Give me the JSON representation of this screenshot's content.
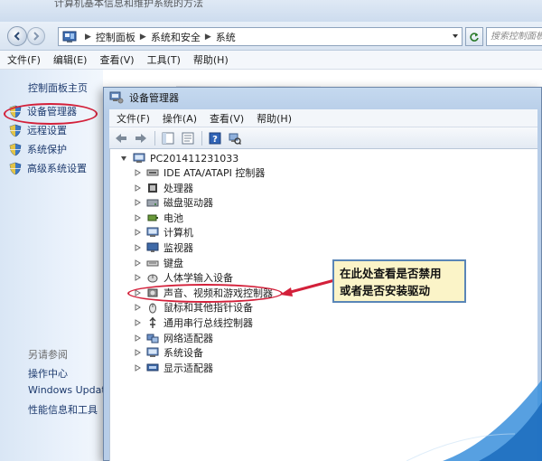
{
  "control_panel": {
    "title_fragment": "计算机基本信息和维护系统的方法",
    "address": {
      "crumbs": [
        "控制面板",
        "系统和安全",
        "系统"
      ]
    },
    "search_placeholder": "搜索控制面板",
    "menu": [
      "文件(F)",
      "编辑(E)",
      "查看(V)",
      "工具(T)",
      "帮助(H)"
    ],
    "sidebar": {
      "home": "控制面板主页",
      "links": [
        "设备管理器",
        "远程设置",
        "系统保护",
        "高级系统设置"
      ],
      "see_also_heading": "另请参阅",
      "see_also": [
        "操作中心",
        "Windows Update",
        "性能信息和工具"
      ]
    }
  },
  "device_manager": {
    "title": "设备管理器",
    "menu": [
      "文件(F)",
      "操作(A)",
      "查看(V)",
      "帮助(H)"
    ],
    "root": "PC201411231033",
    "categories": [
      {
        "label": "IDE ATA/ATAPI 控制器",
        "icon": "ide-controller-icon"
      },
      {
        "label": "处理器",
        "icon": "processor-icon"
      },
      {
        "label": "磁盘驱动器",
        "icon": "disk-drive-icon"
      },
      {
        "label": "电池",
        "icon": "battery-icon"
      },
      {
        "label": "计算机",
        "icon": "computer-icon"
      },
      {
        "label": "监视器",
        "icon": "monitor-icon"
      },
      {
        "label": "键盘",
        "icon": "keyboard-icon"
      },
      {
        "label": "人体学输入设备",
        "icon": "hid-icon"
      },
      {
        "label": "声音、视频和游戏控制器",
        "icon": "sound-icon"
      },
      {
        "label": "鼠标和其他指针设备",
        "icon": "mouse-icon"
      },
      {
        "label": "通用串行总线控制器",
        "icon": "usb-icon"
      },
      {
        "label": "网络适配器",
        "icon": "network-adapter-icon"
      },
      {
        "label": "系统设备",
        "icon": "system-device-icon"
      },
      {
        "label": "显示适配器",
        "icon": "display-adapter-icon"
      }
    ]
  },
  "callout": {
    "line1": "在此处查看是否禁用",
    "line2": "或者是否安装驱动"
  },
  "colors": {
    "highlight_ellipse": "#d3203a",
    "callout_fill": "#fbf4c8",
    "callout_border": "#5a86b7"
  }
}
